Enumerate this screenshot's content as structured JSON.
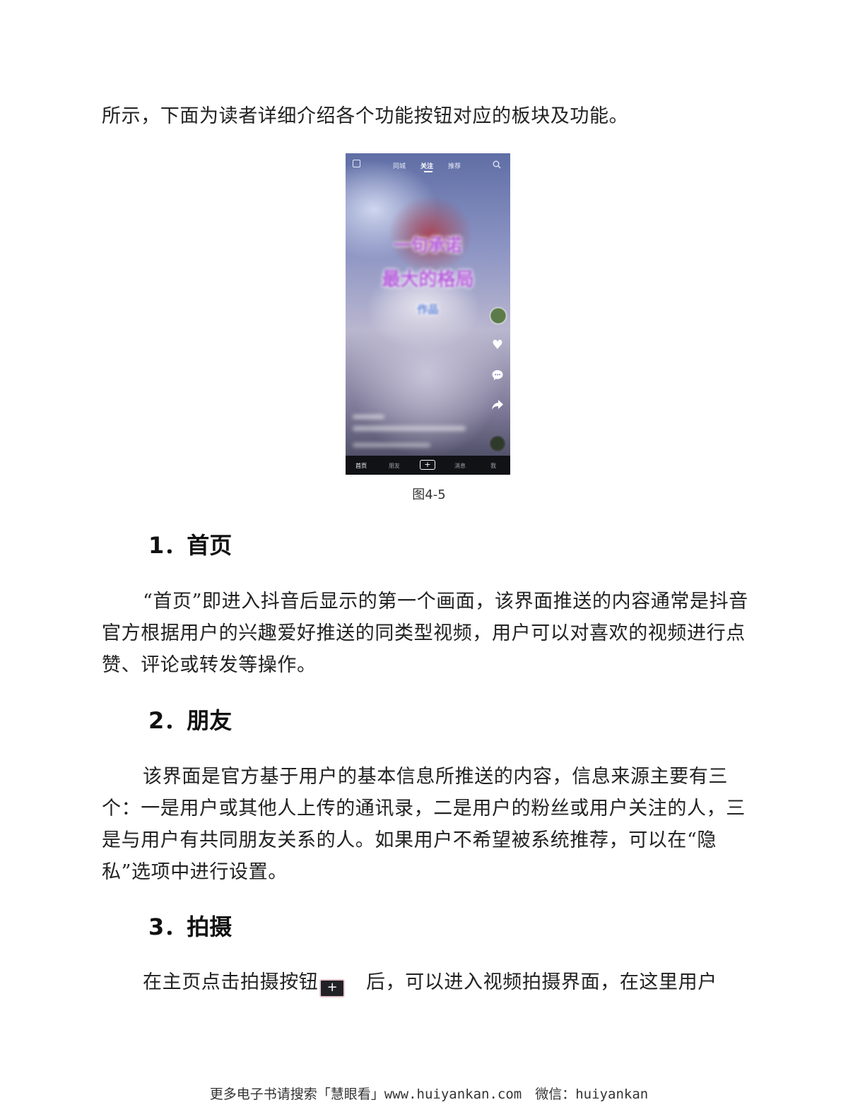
{
  "intro_text": "所示，下面为读者详细介绍各个功能按钮对应的板块及功能。",
  "figure": {
    "caption": "图4-5",
    "phone": {
      "top_tabs": [
        "同城",
        "关注",
        "推荐"
      ],
      "active_tab_index": 1,
      "overlay_text": [
        "一句承诺",
        "最大的格局",
        "作品"
      ],
      "bottom_nav": [
        "首页",
        "朋友",
        "+",
        "消息",
        "我"
      ],
      "icons": [
        "live-icon",
        "search-icon",
        "avatar",
        "heart-icon",
        "comment-icon",
        "share-icon",
        "music-disc-icon"
      ]
    }
  },
  "sections": [
    {
      "heading": "1．首页",
      "body": "“首页”即进入抖音后显示的第一个画面，该界面推送的内容通常是抖音官方根据用户的兴趣爱好推送的同类型视频，用户可以对喜欢的视频进行点赞、评论或转发等操作。"
    },
    {
      "heading": "2．朋友",
      "body": "该界面是官方基于用户的基本信息所推送的内容，信息来源主要有三个：一是用户或其他人上传的通讯录，二是用户的粉丝或用户关注的人，三是与用户有共同朋友关系的人。如果用户不希望被系统推荐，可以在“隐私”选项中进行设置。"
    },
    {
      "heading": "3．拍摄",
      "body_before": "在主页点击拍摄按钮",
      "button_glyph": "+",
      "body_after": "后，可以进入视频拍摄界面，在这里用户"
    }
  ],
  "footer": "更多电子书请搜索「慧眼看」www.huiyankan.com　微信：huiyankan"
}
